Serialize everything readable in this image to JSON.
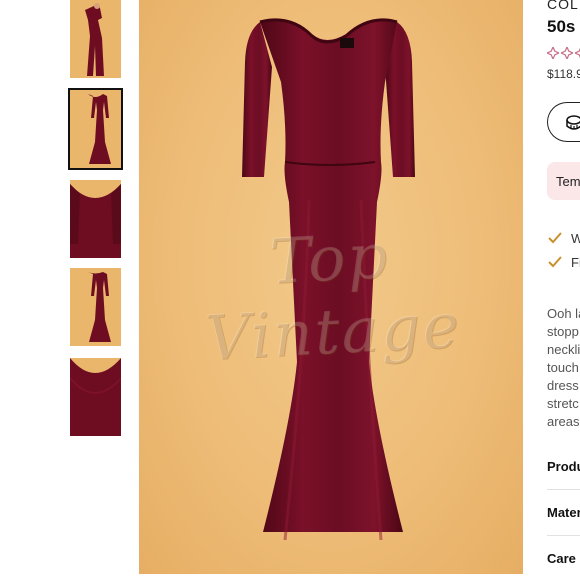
{
  "gallery": {
    "thumbnails": [
      {
        "name": "side-view",
        "selected": false
      },
      {
        "name": "front-view",
        "selected": true
      },
      {
        "name": "neckline-closeup",
        "selected": false
      },
      {
        "name": "back-view",
        "selected": false
      },
      {
        "name": "fabric-detail",
        "selected": false
      }
    ],
    "watermark": "Top Vintage"
  },
  "product": {
    "brand": "COL",
    "title": "50s",
    "rating_stars": 3,
    "price": "$118.9",
    "size_button_icon": "tape-measure-icon",
    "badge": "Tem",
    "features": [
      "W",
      "Fi"
    ],
    "description_lines": [
      "Ooh la",
      "stopp",
      "neckli",
      "touch",
      "dress",
      "stretc",
      "areas"
    ],
    "accordion": [
      "Produ",
      "Mater",
      "Care"
    ]
  },
  "colors": {
    "dress": "#6e0d22",
    "background": "#eebd78",
    "badge_bg": "#fbe6e8",
    "check": "#c8912e",
    "star": "#c56a86"
  }
}
